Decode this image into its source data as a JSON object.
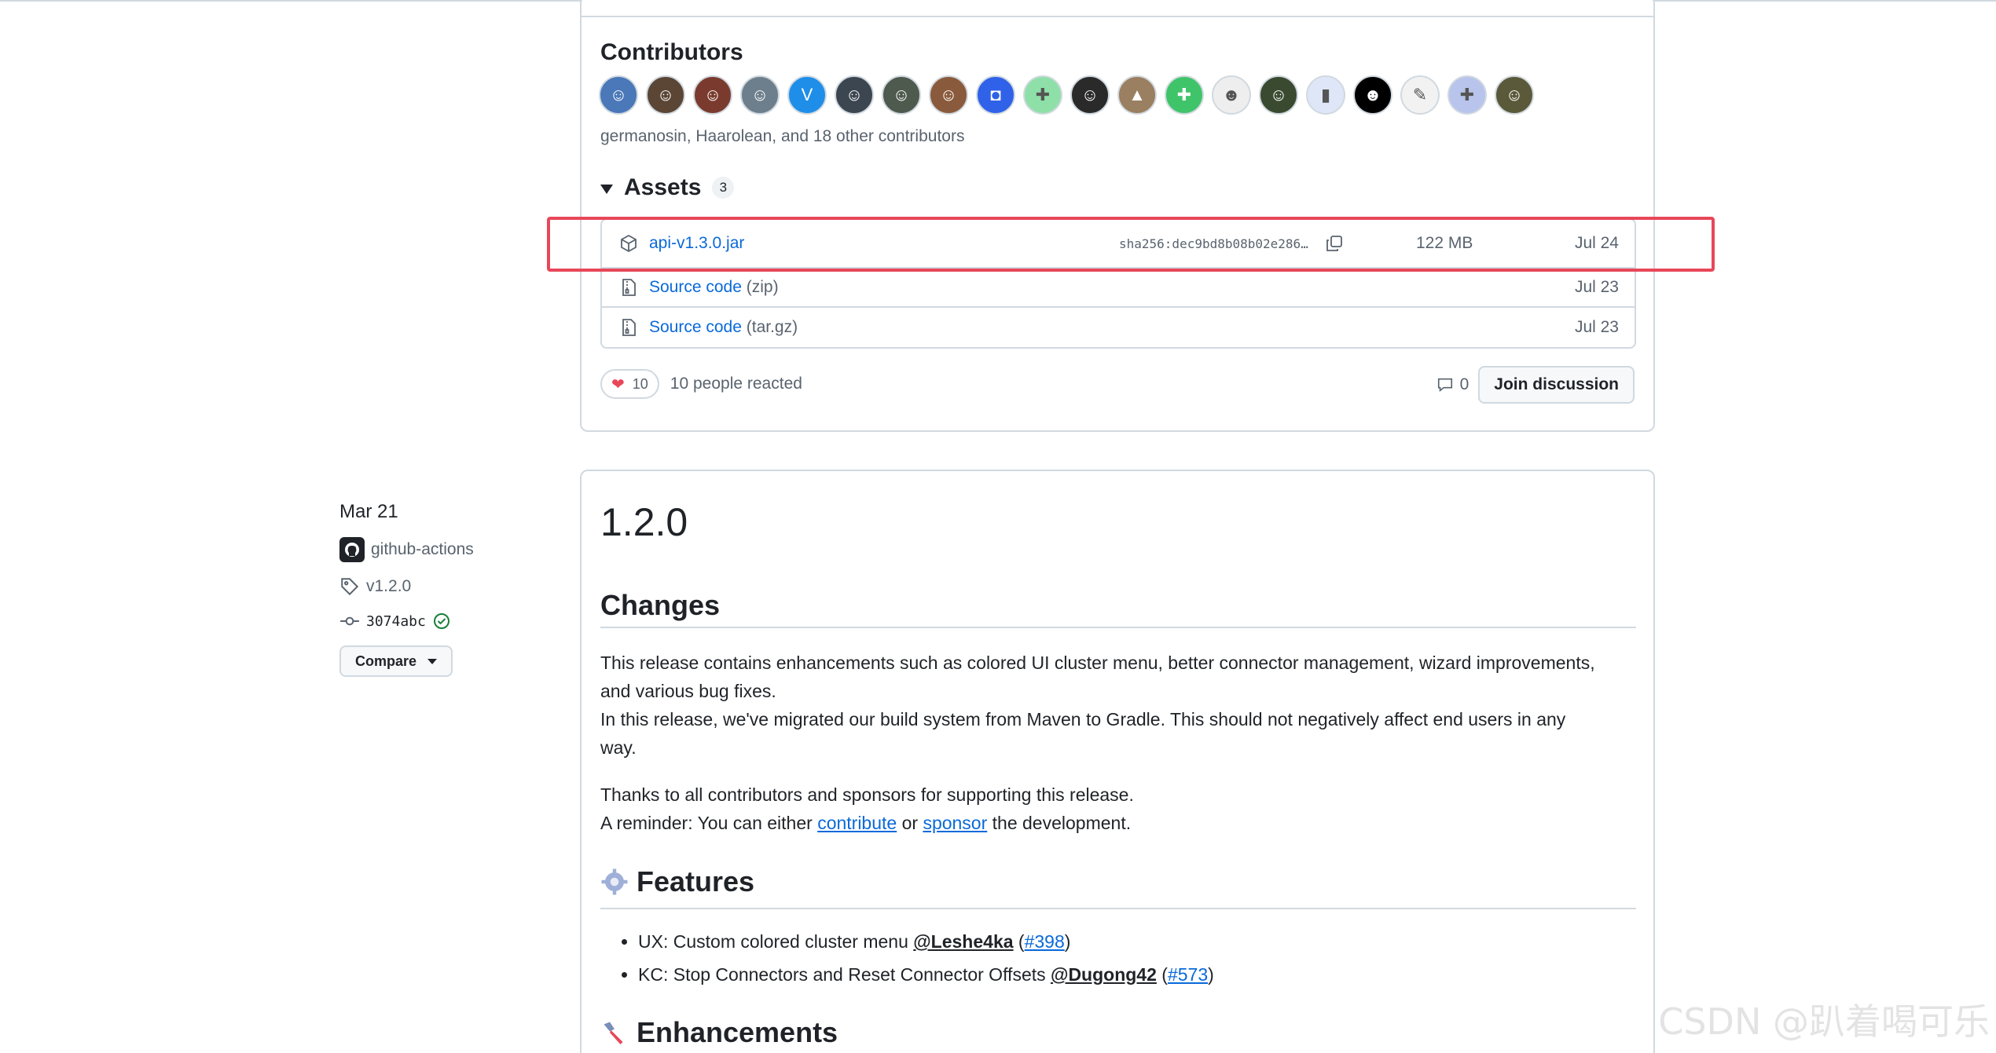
{
  "release_top": {
    "contributors": {
      "title": "Contributors",
      "summary": "germanosin, Haarolean, and 18 other contributors",
      "avatars": [
        {
          "icon": "person-avatar",
          "color": "#4a78b8",
          "glyph": "☺"
        },
        {
          "icon": "person-avatar",
          "color": "#5b4636",
          "glyph": "☺"
        },
        {
          "icon": "person-avatar",
          "color": "#7a3b2e",
          "glyph": "☺"
        },
        {
          "icon": "person-avatar",
          "color": "#6d7f8c",
          "glyph": "☺"
        },
        {
          "icon": "v-logo-avatar",
          "color": "#1f8ee8",
          "glyph": "V"
        },
        {
          "icon": "person-avatar",
          "color": "#3c4650",
          "glyph": "☺"
        },
        {
          "icon": "person-avatar",
          "color": "#4e5a4e",
          "glyph": "☺"
        },
        {
          "icon": "person-avatar",
          "color": "#8a5a3c",
          "glyph": "☺"
        },
        {
          "icon": "bot-avatar",
          "color": "#2f62e8",
          "glyph": "◘"
        },
        {
          "icon": "identicon-avatar",
          "color": "#8fe0a8",
          "glyph": "✚"
        },
        {
          "icon": "person-avatar",
          "color": "#2a2a2a",
          "glyph": "☺"
        },
        {
          "icon": "landscape-avatar",
          "color": "#9a7f60",
          "glyph": "▲"
        },
        {
          "icon": "identicon-avatar",
          "color": "#3fc46a",
          "glyph": "✚"
        },
        {
          "icon": "cartoon-avatar",
          "color": "#eeeeee",
          "glyph": "☻"
        },
        {
          "icon": "person-avatar",
          "color": "#3a4a30",
          "glyph": "☺"
        },
        {
          "icon": "chart-avatar",
          "color": "#dfe6f7",
          "glyph": "▮"
        },
        {
          "icon": "smile-avatar",
          "color": "#000000",
          "glyph": "☻"
        },
        {
          "icon": "sketch-avatar",
          "color": "#f2f2f2",
          "glyph": "✎"
        },
        {
          "icon": "identicon-avatar",
          "color": "#b8c4ec",
          "glyph": "✚"
        },
        {
          "icon": "person-avatar",
          "color": "#5a5a3a",
          "glyph": "☺"
        }
      ]
    },
    "assets": {
      "title": "Assets",
      "count": "3",
      "items": [
        {
          "name": "api-v1.3.0.jar",
          "suffix": "",
          "sha": "sha256:dec9bd8b08b02e286…",
          "size": "122 MB",
          "date": "Jul 24",
          "icon": "package-icon"
        },
        {
          "name": "Source code",
          "suffix": " (zip)",
          "sha": "",
          "size": "",
          "date": "Jul 23",
          "icon": "file-zip-icon"
        },
        {
          "name": "Source code",
          "suffix": " (tar.gz)",
          "sha": "",
          "size": "",
          "date": "Jul 23",
          "icon": "file-zip-icon"
        }
      ]
    },
    "reactions": {
      "heart_count": "10",
      "text": "10 people reacted"
    },
    "discussion": {
      "comment_count": "0",
      "join_label": "Join discussion"
    }
  },
  "release_meta": {
    "date": "Mar 21",
    "author": "github-actions",
    "tag": "v1.2.0",
    "commit": "3074abc",
    "compare_label": "Compare"
  },
  "release": {
    "title": "1.2.0",
    "changes_heading": "Changes",
    "paragraph1_line1": "This release contains enhancements such as colored UI cluster menu, better connector management, wizard improvements,",
    "paragraph1_line2": "and various bug fixes.",
    "paragraph1_line3": "In this release, we've migrated our build system from Maven to Gradle. This should not negatively affect end users in any",
    "paragraph1_line4": "way.",
    "thanks": "Thanks to all contributors and sponsors for supporting this release.",
    "reminder_prefix": "A reminder: You can either ",
    "contribute_link": "contribute",
    "reminder_or": " or ",
    "sponsor_link": "sponsor",
    "reminder_suffix": " the development.",
    "features_heading": "Features",
    "features": [
      {
        "text": "UX: Custom colored cluster menu ",
        "mention": "@Leshe4ka",
        "issue": "#398"
      },
      {
        "text": "KC: Stop Connectors and Reset Connector Offsets ",
        "mention": "@Dugong42",
        "issue": "#573"
      }
    ],
    "enhancements_heading": "Enhancements"
  },
  "watermark": "CSDN @趴着喝可乐",
  "colors": {
    "link": "#0969da",
    "border": "#d1d9e0",
    "highlight": "#e8475a",
    "muted": "#59636e"
  }
}
